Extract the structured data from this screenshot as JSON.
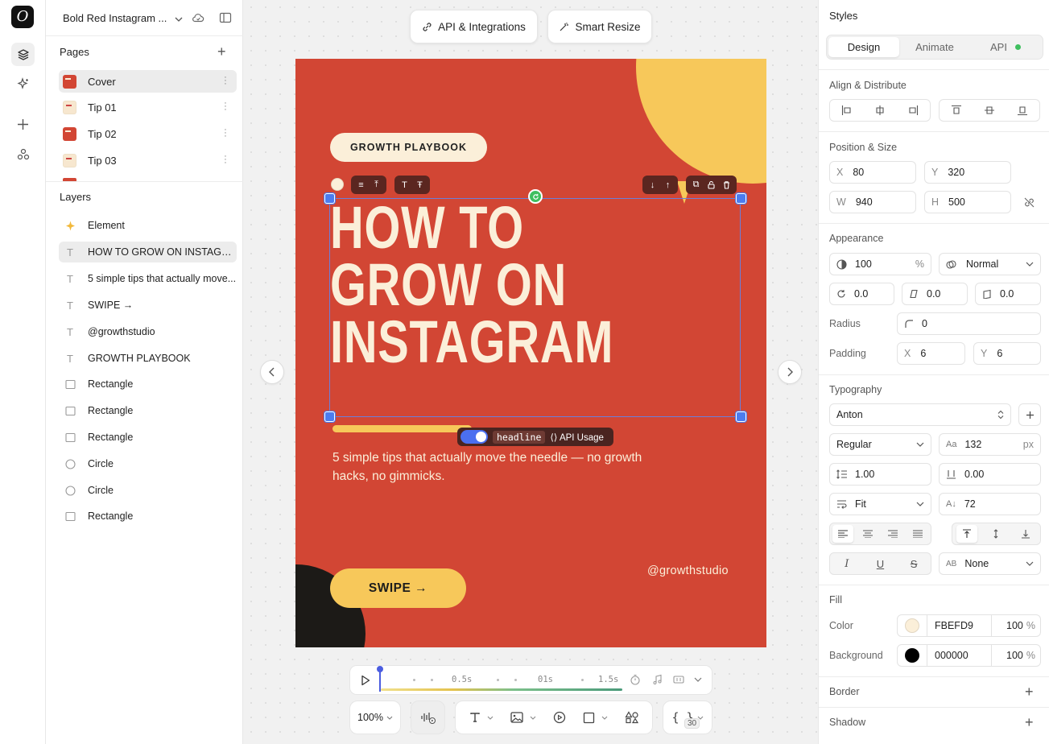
{
  "app": {
    "doc_title": "Bold Red Instagram ..."
  },
  "rail": {
    "icons": [
      "layers-icon",
      "sparkle-icon",
      "plus-icon",
      "components-icon"
    ]
  },
  "pages": {
    "header": "Pages",
    "items": [
      {
        "label": "Cover",
        "thumb": "red",
        "selected": true
      },
      {
        "label": "Tip 01",
        "thumb": "cream"
      },
      {
        "label": "Tip 02",
        "thumb": "red"
      },
      {
        "label": "Tip 03",
        "thumb": "cream"
      }
    ]
  },
  "layers": {
    "header": "Layers",
    "items": [
      {
        "label": "Element",
        "icon": "sparkle"
      },
      {
        "label": "HOW TO GROW ON INSTAGRAM",
        "icon": "text",
        "selected": true
      },
      {
        "label": "5 simple tips that actually move...",
        "icon": "text"
      },
      {
        "label": "SWIPE →",
        "icon": "text"
      },
      {
        "label": "@growthstudio",
        "icon": "text"
      },
      {
        "label": "GROWTH PLAYBOOK",
        "icon": "text"
      },
      {
        "label": "Rectangle",
        "icon": "rect"
      },
      {
        "label": "Rectangle",
        "icon": "rect"
      },
      {
        "label": "Rectangle",
        "icon": "rect"
      },
      {
        "label": "Circle",
        "icon": "circle"
      },
      {
        "label": "Circle",
        "icon": "circle"
      },
      {
        "label": "Rectangle",
        "icon": "rect"
      }
    ]
  },
  "topbar": {
    "api_label": "API & Integrations",
    "resize_label": "Smart Resize"
  },
  "artboard": {
    "pill": "GROWTH PLAYBOOK",
    "headline": [
      "HOW TO",
      "GROW ON",
      "INSTAGRAM"
    ],
    "subtitle": "5 simple tips that actually move the needle — no growth hacks, no gimmicks.",
    "swipe": "SWIPE →",
    "handle": "@growthstudio",
    "colors": {
      "bg": "#d24634",
      "text": "#fbefd9",
      "accent": "#f7c85a",
      "dark": "#1c1a17"
    }
  },
  "selection": {
    "chip": "headline",
    "api_usage": "API Usage"
  },
  "timeline": {
    "marks": [
      "0.5s",
      "01s",
      "1.5s"
    ]
  },
  "dock": {
    "zoom": "100%",
    "badge": "30"
  },
  "styles": {
    "header": "Styles",
    "tabs": [
      "Design",
      "Animate",
      "API"
    ],
    "align_header": "Align & Distribute",
    "position_header": "Position & Size",
    "x_label": "X",
    "x": "80",
    "y_label": "Y",
    "y": "320",
    "w_label": "W",
    "w": "940",
    "h_label": "H",
    "h": "500",
    "appearance_header": "Appearance",
    "opacity": "100",
    "opacity_unit": "%",
    "blend": "Normal",
    "rotation": "0.0",
    "skew_x": "0.0",
    "skew_y": "0.0",
    "radius_label": "Radius",
    "radius": "0",
    "padding_label": "Padding",
    "pad_x_label": "X",
    "pad_x": "6",
    "pad_y_label": "Y",
    "pad_y": "6",
    "typography_header": "Typography",
    "font": "Anton",
    "weight": "Regular",
    "size": "132",
    "size_unit": "px",
    "line_height": "1.00",
    "letter_spacing": "0.00",
    "fit": "Fit",
    "char_spacing": "72",
    "text_case": "None",
    "fill_header": "Fill",
    "color_label": "Color",
    "color_hex": "FBEFD9",
    "color_opacity": "100",
    "color_unit": "%",
    "color_swatch": "#fbefd9",
    "bg_label": "Background",
    "bg_hex": "000000",
    "bg_opacity": "100",
    "bg_unit": "%",
    "bg_swatch": "#000000",
    "border_header": "Border",
    "shadow_header": "Shadow"
  }
}
